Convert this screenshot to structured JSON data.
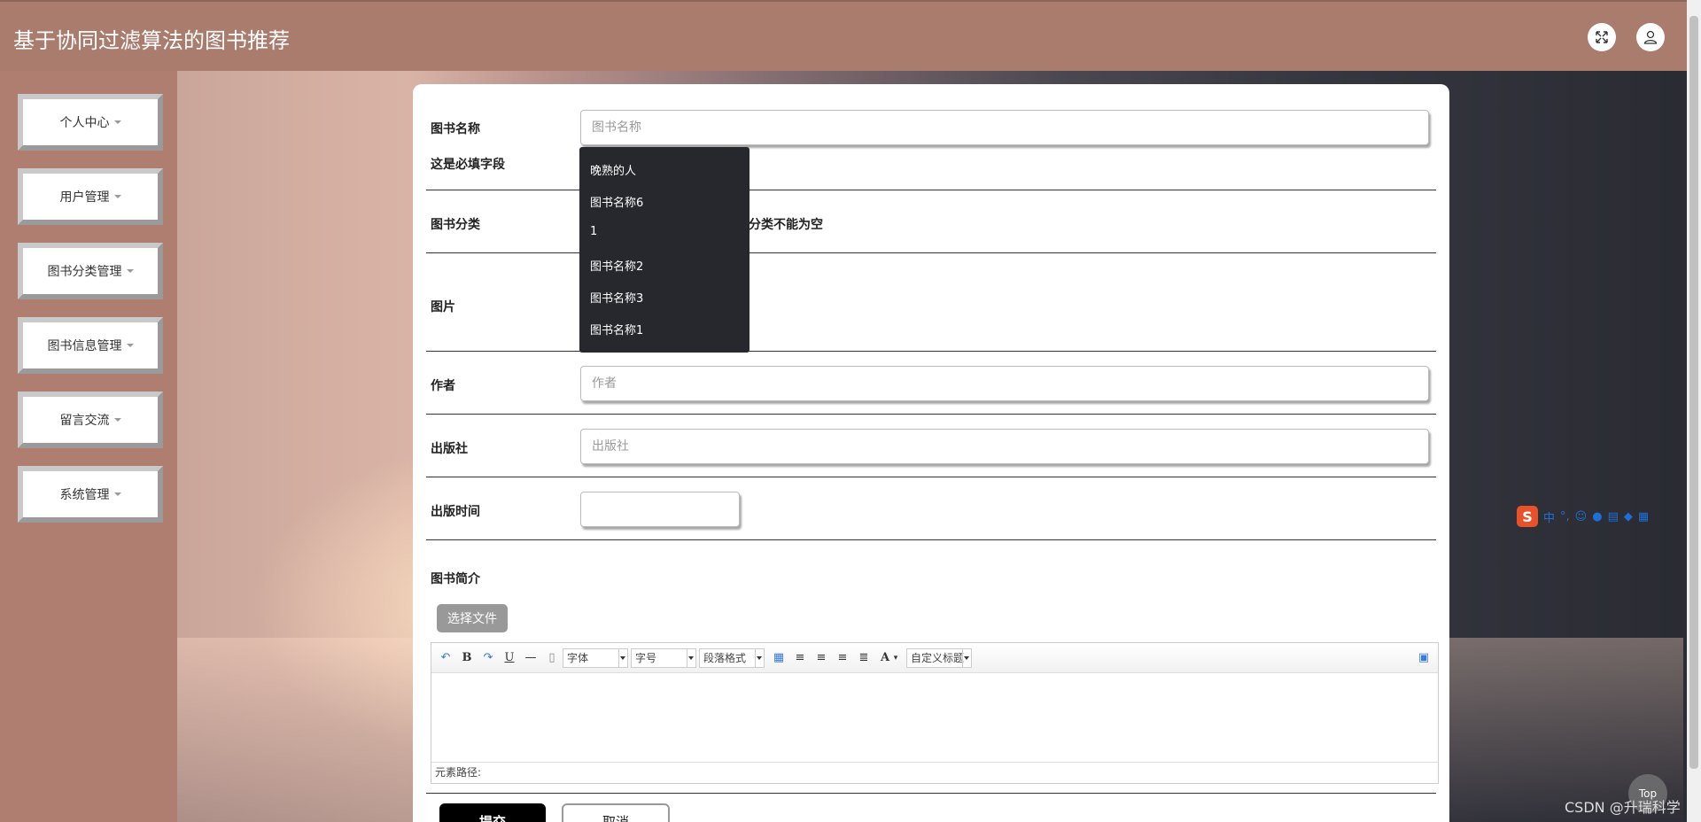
{
  "header": {
    "title": "基于协同过滤算法的图书推荐",
    "fullscreen_icon": "fullscreen-icon",
    "user_icon": "user-icon"
  },
  "sidebar": {
    "items": [
      {
        "label": "个人中心"
      },
      {
        "label": "用户管理"
      },
      {
        "label": "图书分类管理"
      },
      {
        "label": "图书信息管理"
      },
      {
        "label": "留言交流"
      },
      {
        "label": "系统管理"
      }
    ]
  },
  "form": {
    "book_name": {
      "label": "图书名称",
      "placeholder": "图书名称",
      "required_note": "这是必填字段"
    },
    "autocomplete_options": [
      "晚熟的人",
      "图书名称6",
      "1",
      "图书名称2",
      "图书名称3",
      "图书名称1"
    ],
    "category": {
      "label": "图书分类",
      "error": "分类不能为空"
    },
    "image": {
      "label": "图片"
    },
    "author": {
      "label": "作者",
      "placeholder": "作者"
    },
    "publisher": {
      "label": "出版社",
      "placeholder": "出版社"
    },
    "publish_date": {
      "label": "出版时间"
    },
    "intro": {
      "label": "图书简介",
      "file_button": "选择文件"
    },
    "submit": "提交",
    "cancel": "取消"
  },
  "editor": {
    "font_select": "字体",
    "size_select": "字号",
    "paragraph_select": "段落格式",
    "custom_title_select": "自定义标题",
    "status_path": "元素路径:"
  },
  "overlay": {
    "ime_mode": "中",
    "top_button": "Top",
    "watermark": "CSDN @升瑞科学"
  }
}
